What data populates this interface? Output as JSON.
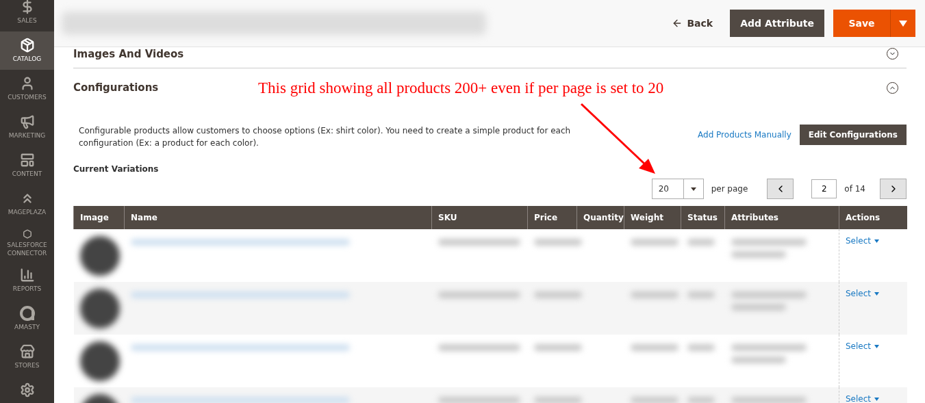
{
  "sidebar": {
    "items": [
      {
        "label": "SALES",
        "selected": false
      },
      {
        "label": "CATALOG",
        "selected": true
      },
      {
        "label": "CUSTOMERS",
        "selected": false
      },
      {
        "label": "MARKETING",
        "selected": false
      },
      {
        "label": "CONTENT",
        "selected": false
      },
      {
        "label": "MAGEPLAZA",
        "selected": false
      },
      {
        "label": "SALESFORCE CONNECTOR",
        "selected": false
      },
      {
        "label": "REPORTS",
        "selected": false
      },
      {
        "label": "AMASTY",
        "selected": false
      },
      {
        "label": "STORES",
        "selected": false
      },
      {
        "selected": false
      }
    ]
  },
  "header": {
    "back": "Back",
    "add_attribute": "Add Attribute",
    "save": "Save"
  },
  "sections": [
    {
      "title": "Images And Videos",
      "expanded": false
    },
    {
      "title": "Configurations",
      "expanded": true
    }
  ],
  "annotation": "This grid showing all products 200+ even if per page is set to 20",
  "configurations": {
    "description": "Configurable products allow customers to choose options (Ex: shirt color). You need to create a simple product for each configuration (Ex: a product for each color).",
    "add_manually": "Add Products Manually",
    "edit_button": "Edit Configurations",
    "subtitle": "Current Variations"
  },
  "pager": {
    "per_page_value": "20",
    "per_page_label": "per page",
    "page": "2",
    "total": "of 14"
  },
  "table": {
    "columns": [
      "Image",
      "Name",
      "SKU",
      "Price",
      "Quantity",
      "Weight",
      "Status",
      "Attributes",
      "Actions"
    ],
    "rows": [
      {
        "action": "Select"
      },
      {
        "action": "Select"
      },
      {
        "action": "Select"
      },
      {
        "action": "Select"
      }
    ]
  }
}
